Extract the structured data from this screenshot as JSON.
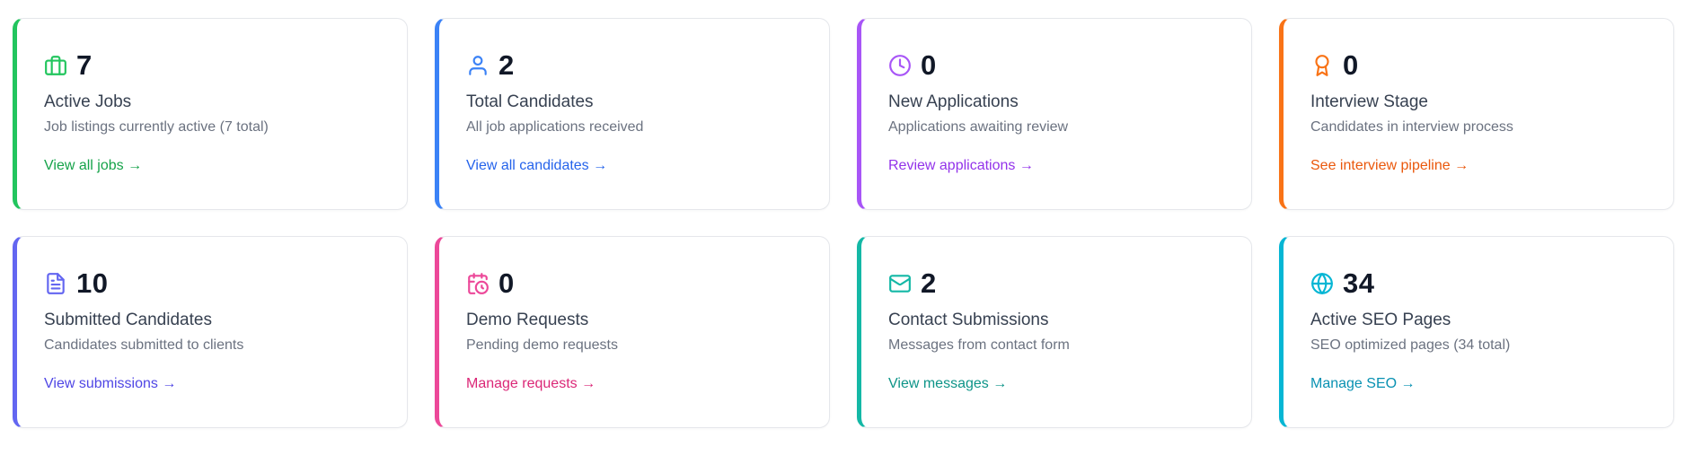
{
  "cards": [
    {
      "icon": "briefcase-icon",
      "accent": "#22c55e",
      "link_color": "#16a34a",
      "count": "7",
      "title": "Active Jobs",
      "description": "Job listings currently active (7 total)",
      "link": "View all jobs →"
    },
    {
      "icon": "user-icon",
      "accent": "#3b82f6",
      "link_color": "#2563eb",
      "count": "2",
      "title": "Total Candidates",
      "description": "All job applications received",
      "link": "View all candidates →"
    },
    {
      "icon": "clock-icon",
      "accent": "#a855f7",
      "link_color": "#9333ea",
      "count": "0",
      "title": "New Applications",
      "description": "Applications awaiting review",
      "link": "Review applications →"
    },
    {
      "icon": "award-icon",
      "accent": "#f97316",
      "link_color": "#ea580c",
      "count": "0",
      "title": "Interview Stage",
      "description": "Candidates in interview process",
      "link": "See interview pipeline →"
    },
    {
      "icon": "file-text-icon",
      "accent": "#6366f1",
      "link_color": "#4f46e5",
      "count": "10",
      "title": "Submitted Candidates",
      "description": "Candidates submitted to clients",
      "link": "View submissions →"
    },
    {
      "icon": "calendar-clock-icon",
      "accent": "#ec4899",
      "link_color": "#db2777",
      "count": "0",
      "title": "Demo Requests",
      "description": "Pending demo requests",
      "link": "Manage requests →"
    },
    {
      "icon": "mail-icon",
      "accent": "#14b8a6",
      "link_color": "#0d9488",
      "count": "2",
      "title": "Contact Submissions",
      "description": "Messages from contact form",
      "link": "View messages →"
    },
    {
      "icon": "globe-icon",
      "accent": "#06b6d4",
      "link_color": "#0891b2",
      "count": "34",
      "title": "Active SEO Pages",
      "description": "SEO optimized pages (34 total)",
      "link": "Manage SEO →"
    }
  ]
}
